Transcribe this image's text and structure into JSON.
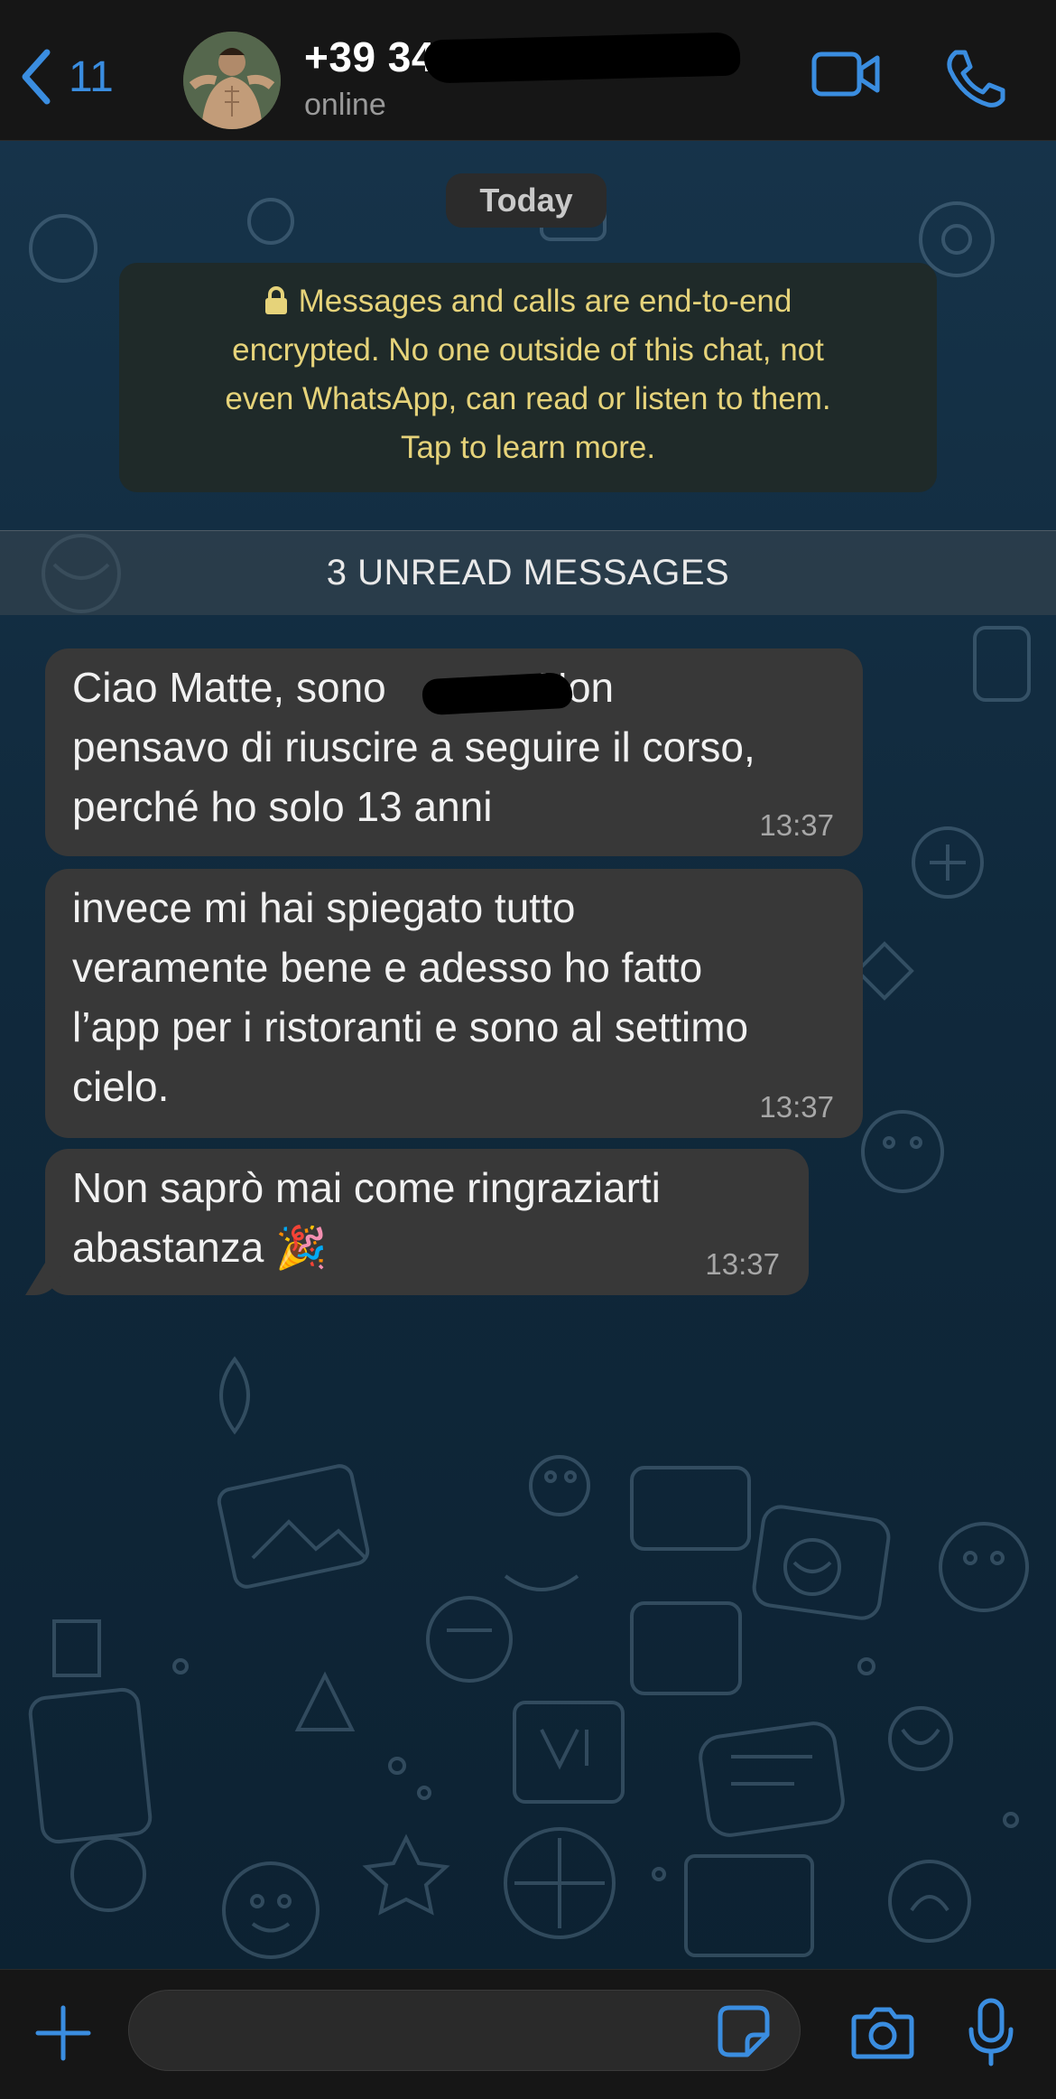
{
  "header": {
    "back_count": "11",
    "contact_name": "+39 34",
    "contact_status": "online",
    "icons": [
      "back-chevron-icon",
      "video-call-icon",
      "phone-call-icon"
    ]
  },
  "chat": {
    "date_label": "Today",
    "encryption_notice": "Messages and calls are end-to-end\nencrypted. No one outside of this chat, not\neven WhatsApp, can read or listen to them.\nTap to learn more.",
    "unread_label": "3 UNREAD MESSAGES",
    "messages": [
      {
        "text_before_redaction": "Ciao Matte, sono",
        "text_after_redaction": "Non\npensavo di riuscire a seguire il corso,\nperché ho solo 13 anni",
        "time": "13:37"
      },
      {
        "text": "invece mi hai spiegato tutto\nveramente bene e adesso ho fatto\nl’app per i ristoranti e sono al settimo\ncielo.",
        "time": "13:37"
      },
      {
        "text": "Non saprò mai come ringraziarti\nabastanza 🎉",
        "time": "13:37"
      }
    ]
  },
  "composer": {
    "input_value": "",
    "icons": [
      "plus-icon",
      "sticker-icon",
      "camera-icon",
      "microphone-icon"
    ]
  },
  "colors": {
    "accent": "#3a8de0",
    "header_bg": "#161616",
    "bubble_bg": "#383838",
    "encryption_text": "#e6d37a",
    "wallpaper": "#13304a"
  }
}
